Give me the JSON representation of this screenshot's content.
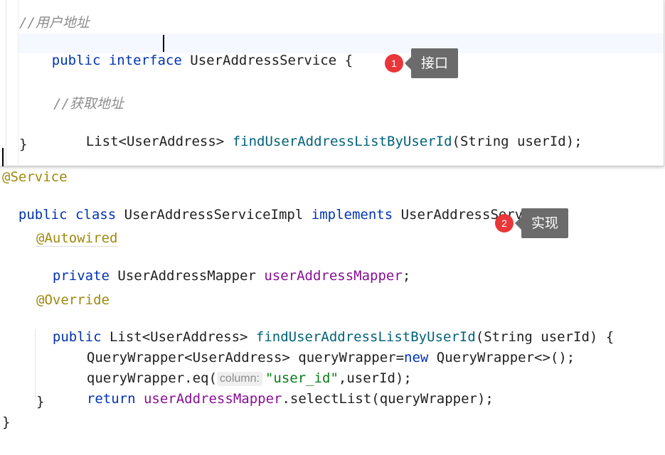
{
  "interface_block": {
    "comment1": "//用户地址",
    "decl": {
      "kw1": "public",
      "kw2": "interface",
      "name": "UserAddressService",
      "brace": "{"
    },
    "comment2": "//获取地址",
    "method": {
      "return_type": "List<UserAddress>",
      "name": "findUserAddressListByUserId",
      "params": "(String userId);"
    },
    "close": "}"
  },
  "impl_block": {
    "annotation": "@Service",
    "decl": {
      "kw1": "public",
      "kw2": "class",
      "name": "UserAddressServiceImpl",
      "kw3": "implements",
      "iface": "UserAddressService",
      "brace": "{"
    },
    "autowired": "@Autowired",
    "field": {
      "kw": "private",
      "type": "UserAddressMapper",
      "name": "userAddressMapper",
      "semi": ";"
    },
    "override": "@Override",
    "method": {
      "kw": "public",
      "return_type": "List<UserAddress>",
      "name": "findUserAddressListByUserId",
      "params": "(String userId) {"
    },
    "body": {
      "line1_a": "QueryWrapper<UserAddress> queryWrapper=",
      "line1_kw": "new",
      "line1_b": " QueryWrapper<>();",
      "line2_a": "queryWrapper.eq(",
      "line2_hint": "column:",
      "line2_str": "\"user_id\"",
      "line2_b": ",userId);",
      "line3_kw": "return",
      "line3_field": "userAddressMapper",
      "line3_b": ".selectList(queryWrapper);"
    },
    "method_close": "}",
    "class_close": "}"
  },
  "callouts": [
    {
      "number": "1",
      "label": "接口"
    },
    {
      "number": "2",
      "label": "实现"
    }
  ],
  "colors": {
    "keyword": "#0033b3",
    "method": "#00627a",
    "field": "#871094",
    "annotation": "#9e880d",
    "comment": "#8c8c8c",
    "string": "#067d17",
    "badge": "#e8363a",
    "tooltip": "#6b6b6b"
  }
}
